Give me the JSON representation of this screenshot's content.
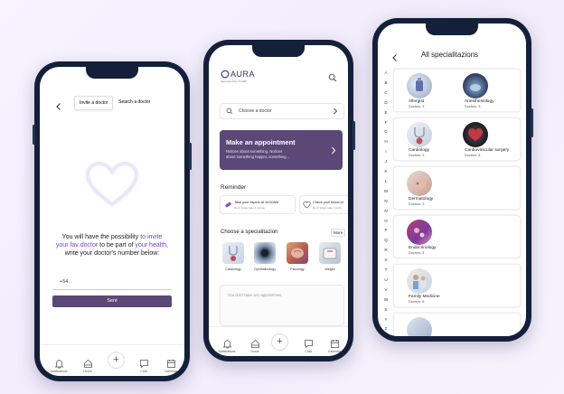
{
  "colors": {
    "brand": "#5b4876",
    "accent": "#7b3fc9",
    "phone_frame": "#14203a"
  },
  "phone1": {
    "tabs": [
      "Invite a doctor",
      "Search a doctor"
    ],
    "message_part1": "You will have the possibility",
    "message_highlight1": "to invite",
    "message_highlight2": "your fav doctor",
    "message_part2": "to be part of",
    "message_highlight3": "your health,",
    "message_part3": "write your doctor's number below:",
    "phone_value": "+54",
    "send_label": "Sent",
    "nav": [
      "Notifications",
      "Home",
      "",
      "Chat",
      "Calendar"
    ]
  },
  "phone2": {
    "logo": "AURA",
    "logo_sub": "Sponsored by CLARK",
    "search_placeholder": "Choose a doctor",
    "appointment": {
      "title": "Make an appointment",
      "line1": "Notices about something. Notices",
      "line2": "about something happnr, something..."
    },
    "reminder_title": "Reminder",
    "reminders": [
      {
        "title": "Take your aspirin at 10:00AM",
        "sub": "Don't forget take it at time"
      },
      {
        "title": "Check your blood pr",
        "sub": "Don't forget take it at tim"
      }
    ],
    "spec_title": "Choose a specialitazion",
    "more": "More",
    "specs": [
      "Cardiology",
      "Ophthalmology",
      "Psicology",
      "Weight"
    ],
    "empty": "You don't have any appointment",
    "nav": [
      "Notifications",
      "Home",
      "",
      "Chat",
      "Calendar"
    ]
  },
  "phone3": {
    "title": "All specialitazions",
    "letters": [
      "A",
      "B",
      "C",
      "D",
      "E",
      "F",
      "G",
      "H",
      "I",
      "J",
      "K",
      "L",
      "M",
      "N",
      "Ñ",
      "O",
      "P",
      "Q",
      "R",
      "S",
      "T",
      "U",
      "V",
      "W",
      "X",
      "Y",
      "Z"
    ],
    "rows": [
      [
        {
          "name": "Allergist",
          "count": "Doctors: 3"
        },
        {
          "name": "Anesthesiology",
          "count": "Doctors: 3"
        }
      ],
      [
        {
          "name": "Cardiology",
          "count": "Doctors: 9"
        },
        {
          "name": "Cardiovascular surgery",
          "count": "Doctors: 8"
        }
      ],
      [
        {
          "name": "Dermatology",
          "count": "Doctors: 3"
        }
      ],
      [
        {
          "name": "Endocrinology",
          "count": "Doctors: 3"
        }
      ],
      [
        {
          "name": "Family Medicine",
          "count": "Doctors: 8"
        }
      ]
    ]
  }
}
